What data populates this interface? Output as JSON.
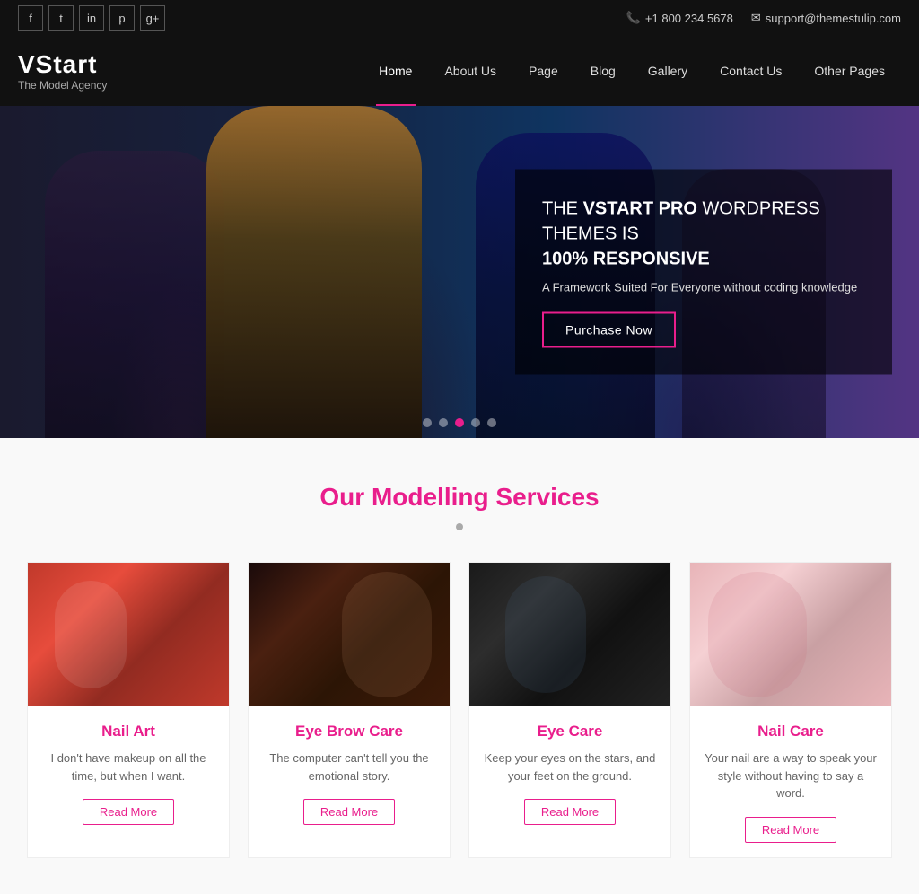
{
  "topbar": {
    "phone": "+1 800 234 5678",
    "email": "support@themestulip.com",
    "social": [
      {
        "name": "facebook",
        "icon": "f"
      },
      {
        "name": "twitter",
        "icon": "t"
      },
      {
        "name": "linkedin",
        "icon": "in"
      },
      {
        "name": "pinterest",
        "icon": "p"
      },
      {
        "name": "google-plus",
        "icon": "g+"
      }
    ]
  },
  "logo": {
    "title": "VStart",
    "subtitle": "The Model Agency"
  },
  "nav": {
    "items": [
      {
        "label": "Home",
        "active": true
      },
      {
        "label": "About Us",
        "active": false
      },
      {
        "label": "Page",
        "active": false
      },
      {
        "label": "Blog",
        "active": false
      },
      {
        "label": "Gallery",
        "active": false
      },
      {
        "label": "Contact Us",
        "active": false
      },
      {
        "label": "Other Pages",
        "active": false
      }
    ]
  },
  "hero": {
    "heading_prefix": "THE ",
    "heading_bold": "VSTART PRO",
    "heading_suffix": " WORDPRESS THEMES IS",
    "heading2": "100% RESPONSIVE",
    "subtext": "A Framework Suited For Everyone without coding knowledge",
    "cta_label": "Purchase Now",
    "dots": [
      false,
      false,
      true,
      false,
      false
    ]
  },
  "services": {
    "section_title_plain": "Our Modelling ",
    "section_title_colored": "Services",
    "cards": [
      {
        "id": "nail-art",
        "title": "Nail Art",
        "description": "I don't have makeup on all the time, but when I want.",
        "read_more": "Read More"
      },
      {
        "id": "eye-brow-care",
        "title": "Eye Brow Care",
        "description": "The computer can't tell you the emotional story.",
        "read_more": "Read More"
      },
      {
        "id": "eye-care",
        "title": "Eye Care",
        "description": "Keep your eyes on the stars, and your feet on the ground.",
        "read_more": "Read More"
      },
      {
        "id": "nail-care",
        "title": "Nail Care",
        "description": "Your nail are a way to speak your style without having to say a word.",
        "read_more": "Read More"
      }
    ]
  }
}
